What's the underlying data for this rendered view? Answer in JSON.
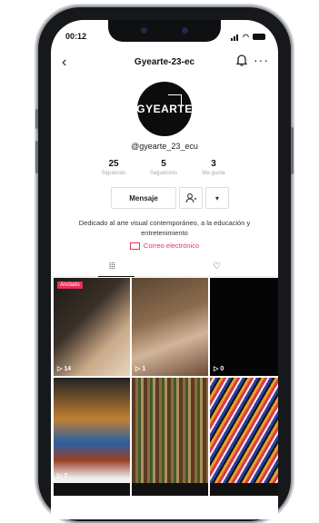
{
  "status_bar": {
    "time": "00:12"
  },
  "header": {
    "title": "Gyearte-23-ec"
  },
  "profile": {
    "avatar_text": "GYEARTE",
    "handle": "@gyearte_23_ecu",
    "stats": [
      {
        "value": "25",
        "label": "Siguiendo"
      },
      {
        "value": "5",
        "label": "Seguidores"
      },
      {
        "value": "3",
        "label": "Me gusta"
      }
    ],
    "message_button": "Mensaje",
    "bio": "Dedicado al arte visual contemporáneo, a la educación y entretenimiento",
    "email_label": "Correo electrónico"
  },
  "videos": [
    {
      "views": "14",
      "pinned_label": "Anclado"
    },
    {
      "views": "1"
    },
    {
      "views": "0"
    },
    {
      "views": "7"
    },
    {
      "views": ""
    },
    {
      "views": ""
    }
  ],
  "colors": {
    "accent": "#e8305a"
  }
}
